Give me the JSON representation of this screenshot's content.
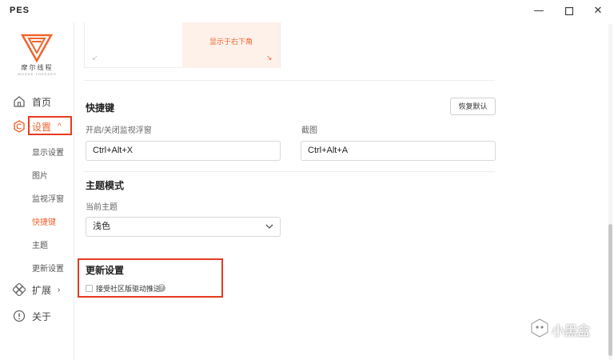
{
  "window": {
    "title": "PES",
    "minimize_icon": "minimize-icon",
    "maximize_icon": "maximize-icon",
    "close_icon": "close-icon"
  },
  "brand": {
    "name": "摩尔线程",
    "subname": "MOORE THREADS",
    "accent_color": "#f0642d"
  },
  "sidebar": {
    "items": [
      {
        "label": "首页",
        "icon": "home-icon"
      },
      {
        "label": "设置",
        "icon": "settings-hex-icon",
        "expanded_glyph": "^"
      },
      {
        "label": "扩展",
        "icon": "extension-icon",
        "collapsed_glyph": "›"
      },
      {
        "label": "关于",
        "icon": "info-icon"
      }
    ],
    "settings_sub": [
      "显示设置",
      "图片",
      "监视浮窗",
      "快捷键",
      "主题",
      "更新设置"
    ],
    "active_sub": "快捷键"
  },
  "preview": {
    "position_label": "显示于右下角"
  },
  "shortcuts": {
    "title": "快捷键",
    "reset_label": "恢复默认",
    "toggle_overlay_label": "开启/关闭监视浮窗",
    "toggle_overlay_value": "Ctrl+Alt+X",
    "screenshot_label": "截图",
    "screenshot_value": "Ctrl+Alt+A"
  },
  "theme": {
    "title": "主题模式",
    "current_label": "当前主题",
    "current_value": "浅色"
  },
  "update": {
    "title": "更新设置",
    "community_driver_label": "接受社区版驱动推送",
    "community_driver_checked": false,
    "help_glyph": "?"
  },
  "watermark": {
    "text": "小黑盒"
  }
}
